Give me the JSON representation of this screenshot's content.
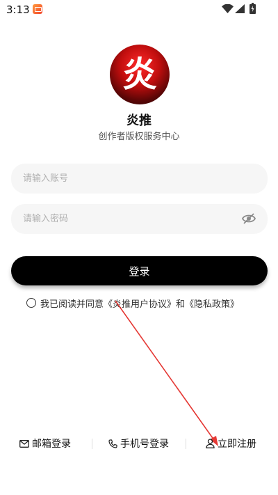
{
  "status_bar": {
    "time": "3:13"
  },
  "app": {
    "logo_char": "炎",
    "name": "炎推",
    "subtitle": "创作者版权服务中心"
  },
  "form": {
    "account_placeholder": "请输入账号",
    "password_placeholder": "请输入密码",
    "login_label": "登录"
  },
  "agreement": {
    "prefix": "我已阅读并同意",
    "user_agreement": "《炎推用户协议》",
    "and": "和",
    "privacy_policy": "《隐私政策》"
  },
  "bottom_options": {
    "email_login": "邮箱登录",
    "phone_login": "手机号登录",
    "register": "立即注册"
  },
  "colors": {
    "accent": "#000000",
    "annotation": "#e53935",
    "input_bg": "#f6f6f6"
  },
  "icons": [
    "mail-icon",
    "phone-icon",
    "user-icon",
    "eye-off-icon",
    "wifi-icon",
    "signal-icon",
    "battery-icon"
  ]
}
